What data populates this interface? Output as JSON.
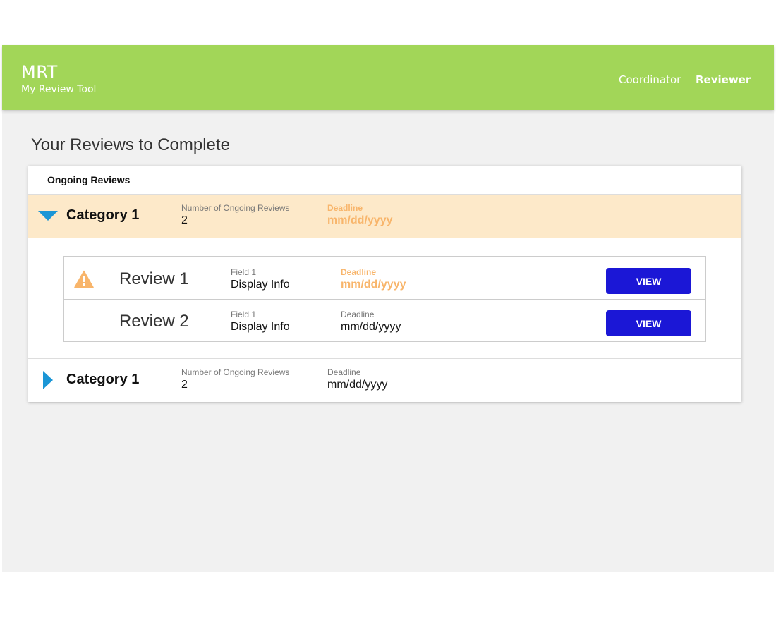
{
  "header": {
    "app_name": "MRT",
    "app_subtitle": "My Review Tool",
    "nav": [
      {
        "label": "Coordinator",
        "active": false
      },
      {
        "label": "Reviewer",
        "active": true
      }
    ],
    "bar_color": "#a2d658"
  },
  "page": {
    "title": "Your Reviews to Complete"
  },
  "panel": {
    "heading": "Ongoing Reviews",
    "categories": [
      {
        "name": "Category 1",
        "expanded": true,
        "count_label": "Number of Ongoing Reviews",
        "count": "2",
        "deadline_label": "Deadline",
        "deadline": "mm/dd/yyyy",
        "deadline_warning": true,
        "reviews": [
          {
            "name": "Review 1",
            "warning": true,
            "field_label": "Field 1",
            "field_value": "Display Info",
            "deadline_label": "Deadline",
            "deadline": "mm/dd/yyyy",
            "button_label": "VIEW"
          },
          {
            "name": "Review 2",
            "warning": false,
            "field_label": "Field 1",
            "field_value": "Display Info",
            "deadline_label": "Deadline",
            "deadline": "mm/dd/yyyy",
            "button_label": "VIEW"
          }
        ]
      },
      {
        "name": "Category 1",
        "expanded": false,
        "count_label": "Number of Ongoing Reviews",
        "count": "2",
        "deadline_label": "Deadline",
        "deadline": "mm/dd/yyyy",
        "deadline_warning": false
      }
    ]
  },
  "colors": {
    "accent_blue": "#1b96d6",
    "button": "#1b17d6",
    "warning": "#f8b56b",
    "expanded_row": "#fde9c9"
  },
  "icons": {
    "expanded_caret": "caret-down-icon",
    "collapsed_caret": "caret-right-icon",
    "warning": "warning-triangle-icon"
  }
}
